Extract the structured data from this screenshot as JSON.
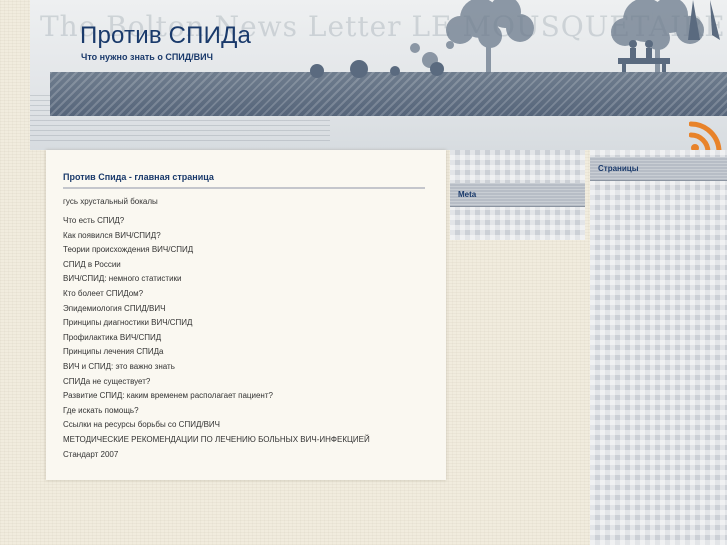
{
  "header": {
    "title": "Против СПИДа",
    "tagline": "Что нужно знать о СПИД/ВИЧ",
    "newsprint_text": "The Bolton News Letter  LE MOUSQUETAIRE"
  },
  "rss": {
    "icon": "rss-icon",
    "color": "#e8832a"
  },
  "content": {
    "title": "Против Спида - главная страница",
    "intro": "гусь хрустальный бокалы",
    "links": [
      "Что есть СПИД?",
      "Как появился ВИЧ/СПИД?",
      "Теории происхождения ВИЧ/СПИД",
      "СПИД в России",
      "ВИЧ/СПИД: немного статистики",
      "Кто болеет СПИДом?",
      "Эпидемиология СПИД/ВИЧ",
      "Принципы диагностики ВИЧ/СПИД",
      "Профилактика ВИЧ/СПИД",
      "Принципы лечения СПИДа",
      "ВИЧ и СПИД: это важно знать",
      "СПИДа не существует?",
      "Развитие СПИД: каким временем располагает пациент?",
      "Где искать помощь?",
      "Ссылки на ресурсы борьбы со СПИД/ВИЧ",
      "МЕТОДИЧЕСКИЕ РЕКОМЕНДАЦИИ ПО ЛЕЧЕНИЮ БОЛЬНЫХ ВИЧ-ИНФЕКЦИЕЙ",
      "Стандарт 2007"
    ]
  },
  "sidebar": {
    "meta_title": "Meta",
    "pages_title": "Страницы"
  },
  "colors": {
    "title": "#1a3a6b",
    "band": "#5f6e82",
    "background": "#f1ecde"
  }
}
